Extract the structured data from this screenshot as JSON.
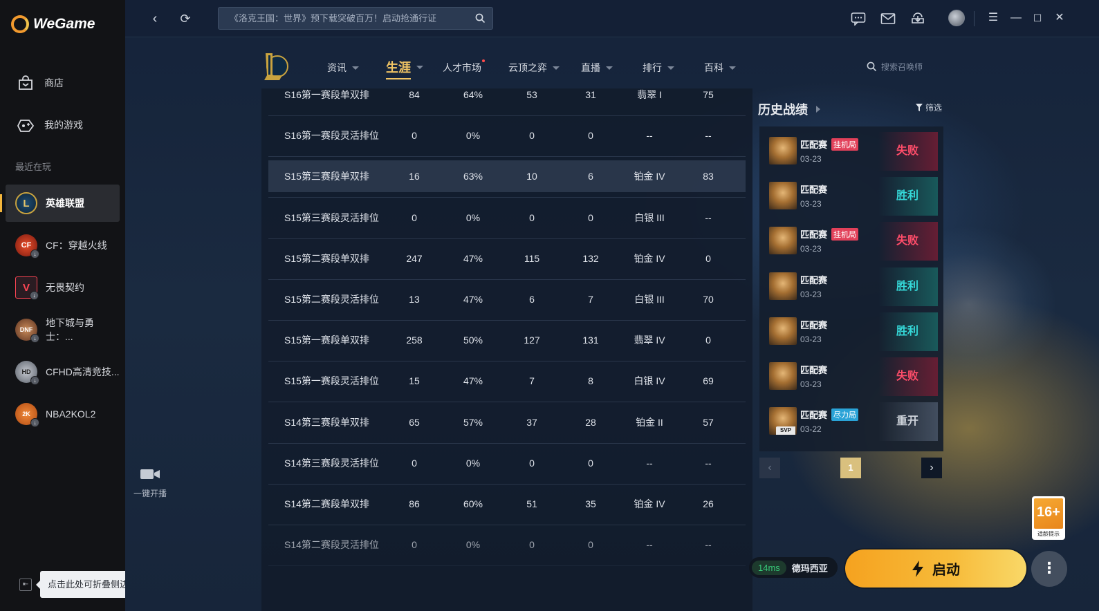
{
  "app": {
    "name": "WeGame"
  },
  "sidebar": {
    "items": [
      {
        "label": "商店",
        "icon": "store-bag-icon"
      },
      {
        "label": "我的游戏",
        "icon": "gamepad-icon"
      }
    ],
    "recent_label": "最近在玩",
    "games": [
      {
        "label": "英雄联盟",
        "icon": "league-of-legends-icon",
        "active": true
      },
      {
        "label": "CF：穿越火线",
        "icon": "crossfire-icon"
      },
      {
        "label": "无畏契约",
        "icon": "valorant-icon"
      },
      {
        "label": "地下城与勇士：...",
        "icon": "dnf-icon"
      },
      {
        "label": "CFHD高清竞技...",
        "icon": "cfhd-icon"
      },
      {
        "label": "NBA2KOL2",
        "icon": "nba2kol2-icon"
      }
    ],
    "collapse_tooltip": "点击此处可折叠侧边栏"
  },
  "topbar": {
    "search_placeholder": "《洛克王国：世界》预下载突破百万！启动抢通行证"
  },
  "game_nav": {
    "tabs": [
      {
        "label": "资讯",
        "caret": true
      },
      {
        "label": "生涯",
        "caret": true,
        "active": true
      },
      {
        "label": "人才市场",
        "caret": false,
        "dot": true
      },
      {
        "label": "云顶之弈",
        "caret": true
      },
      {
        "label": "直播",
        "caret": true
      },
      {
        "label": "排行",
        "caret": true
      },
      {
        "label": "百科",
        "caret": true
      }
    ],
    "summoner_search_placeholder": "搜索召唤师"
  },
  "rank_table": {
    "rows": [
      [
        "S16第一赛段单双排",
        "84",
        "64%",
        "53",
        "31",
        "翡翠 I",
        "75"
      ],
      [
        "S16第一赛段灵活排位",
        "0",
        "0%",
        "0",
        "0",
        "--",
        "--"
      ],
      [
        "S15第三赛段单双排",
        "16",
        "63%",
        "10",
        "6",
        "铂金 IV",
        "83"
      ],
      [
        "S15第三赛段灵活排位",
        "0",
        "0%",
        "0",
        "0",
        "白银 III",
        "--"
      ],
      [
        "S15第二赛段单双排",
        "247",
        "47%",
        "115",
        "132",
        "铂金 IV",
        "0"
      ],
      [
        "S15第二赛段灵活排位",
        "13",
        "47%",
        "6",
        "7",
        "白银 III",
        "70"
      ],
      [
        "S15第一赛段单双排",
        "258",
        "50%",
        "127",
        "131",
        "翡翠 IV",
        "0"
      ],
      [
        "S15第一赛段灵活排位",
        "15",
        "47%",
        "7",
        "8",
        "白银 IV",
        "69"
      ],
      [
        "S14第三赛段单双排",
        "65",
        "57%",
        "37",
        "28",
        "铂金 II",
        "57"
      ],
      [
        "S14第三赛段灵活排位",
        "0",
        "0%",
        "0",
        "0",
        "--",
        "--"
      ],
      [
        "S14第二赛段单双排",
        "86",
        "60%",
        "51",
        "35",
        "铂金 IV",
        "26"
      ],
      [
        "S14第二赛段灵活排位",
        "0",
        "0%",
        "0",
        "0",
        "--",
        "--"
      ]
    ]
  },
  "live": {
    "label": "一键开播"
  },
  "history": {
    "title": "历史战绩",
    "filter_label": "筛选",
    "matches": [
      {
        "mode": "匹配赛",
        "tag": "挂机局",
        "tag_color": "red",
        "date": "03-23",
        "result": "失败",
        "result_type": "lose"
      },
      {
        "mode": "匹配赛",
        "tag": "",
        "date": "03-23",
        "result": "胜利",
        "result_type": "win"
      },
      {
        "mode": "匹配赛",
        "tag": "挂机局",
        "tag_color": "red",
        "date": "03-23",
        "result": "失败",
        "result_type": "lose"
      },
      {
        "mode": "匹配赛",
        "tag": "",
        "date": "03-23",
        "result": "胜利",
        "result_type": "win"
      },
      {
        "mode": "匹配赛",
        "tag": "",
        "date": "03-23",
        "result": "胜利",
        "result_type": "win"
      },
      {
        "mode": "匹配赛",
        "tag": "",
        "date": "03-23",
        "result": "失败",
        "result_type": "lose"
      },
      {
        "mode": "匹配赛",
        "tag": "尽力局",
        "tag_color": "blue",
        "date": "03-22",
        "result": "重开",
        "result_type": "remake",
        "svp": "SVP"
      }
    ],
    "page": "1"
  },
  "age_badge": {
    "rating": "16+",
    "caption": "适龄提示"
  },
  "launch": {
    "ping": "14ms",
    "server": "德玛西亚",
    "button_label": "启动",
    "more_label": "⋮"
  }
}
